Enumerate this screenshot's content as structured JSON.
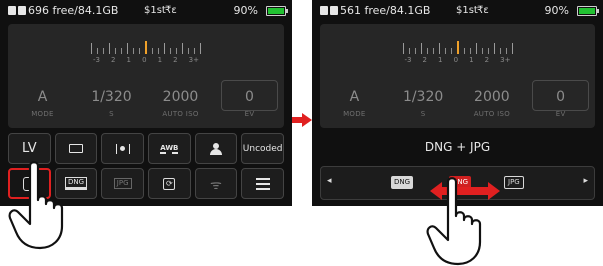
{
  "left_screen": {
    "status": {
      "storage": "696 free/84.1GB",
      "burst": "$1st",
      "stabilizer": "₹ε",
      "battery_percent": "90%"
    },
    "meter_scale": [
      "-3",
      "2",
      "1",
      "0",
      "1",
      "2",
      "3+"
    ],
    "values": [
      {
        "value": "A",
        "label": "MODE"
      },
      {
        "value": "1/320",
        "label": "S"
      },
      {
        "value": "2000",
        "label": "AUTO ISO"
      },
      {
        "value": "0",
        "label": "EV"
      }
    ],
    "grid": {
      "row1": {
        "lv": "LV",
        "uncoded": "Uncoded",
        "awb": "AWB"
      },
      "row2": {
        "dng": "DNG",
        "jpg": "JPG"
      }
    }
  },
  "right_screen": {
    "status": {
      "storage": "561 free/84.1GB",
      "burst": "$1st",
      "stabilizer": "₹ε",
      "battery_percent": "90%"
    },
    "meter_scale": [
      "-3",
      "2",
      "1",
      "0",
      "1",
      "2",
      "3+"
    ],
    "values": [
      {
        "value": "A",
        "label": "MODE"
      },
      {
        "value": "1/320",
        "label": "S"
      },
      {
        "value": "2000",
        "label": "AUTO ISO"
      },
      {
        "value": "0",
        "label": "EV"
      }
    ],
    "format_title": "DNG + JPG",
    "format_options": {
      "left": "DNG",
      "middle": "DNG",
      "right": "JPG"
    },
    "arrows": {
      "left": "◂",
      "right": "▸"
    }
  },
  "colors": {
    "battery": "#22c232",
    "selection": "#e02020",
    "meter_center": "#f0a12a",
    "arrow": "#e02020"
  }
}
